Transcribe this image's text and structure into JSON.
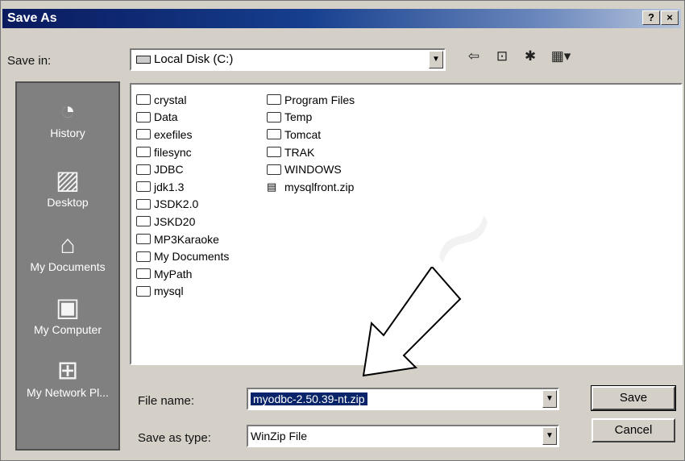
{
  "title": "Save As",
  "title_buttons": {
    "help": "?",
    "close": "×"
  },
  "save_in": {
    "label": "Save in:",
    "value": "Local Disk (C:)"
  },
  "toolbar": {
    "icons": [
      "back-icon",
      "up-folder-icon",
      "new-folder-icon",
      "view-menu-icon"
    ]
  },
  "places": [
    "History",
    "Desktop",
    "My Documents",
    "My Computer",
    "My Network Pl..."
  ],
  "files_col1": [
    "crystal",
    "Data",
    "exefiles",
    "filesync",
    "JDBC",
    "jdk1.3",
    "JSDK2.0",
    "JSKD20",
    "MP3Karaoke",
    "My Documents",
    "MyPath",
    "mysql"
  ],
  "files_col2": [
    "Program Files",
    "Temp",
    "Tomcat",
    "TRAK",
    "WINDOWS",
    "mysqlfront.zip"
  ],
  "file_name": {
    "label": "File name:",
    "value": "myodbc-2.50.39-nt.zip"
  },
  "save_as_type": {
    "label": "Save as type:",
    "value": "WinZip File"
  },
  "buttons": {
    "save": "Save",
    "cancel": "Cancel"
  }
}
